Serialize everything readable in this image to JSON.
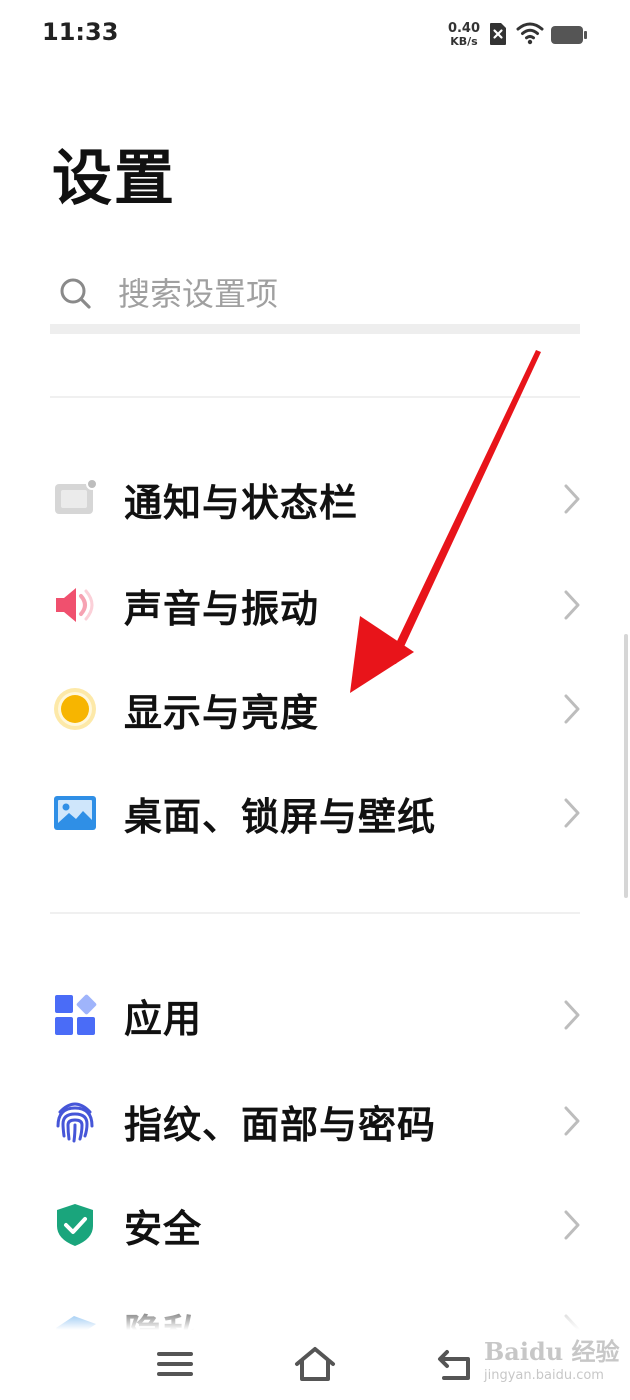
{
  "status_bar": {
    "time": "11:33",
    "net_speed": "0.40",
    "net_speed_unit": "KB/s",
    "icons": [
      "sim-disabled-icon",
      "wifi-icon",
      "battery-icon"
    ]
  },
  "page_title": "设置",
  "search": {
    "placeholder": "搜索设置项"
  },
  "groups": [
    {
      "items": [
        {
          "label": "通知与状态栏",
          "icon": "notification-icon"
        },
        {
          "label": "声音与振动",
          "icon": "speaker-icon"
        },
        {
          "label": "显示与亮度",
          "icon": "brightness-icon"
        },
        {
          "label": "桌面、锁屏与壁纸",
          "icon": "wallpaper-icon"
        }
      ]
    },
    {
      "items": [
        {
          "label": "应用",
          "icon": "apps-icon"
        },
        {
          "label": "指纹、面部与密码",
          "icon": "fingerprint-icon"
        },
        {
          "label": "安全",
          "icon": "shield-icon"
        },
        {
          "label": "隐私",
          "icon": "privacy-icon"
        }
      ]
    }
  ],
  "nav_bar": {
    "buttons": [
      "menu-icon",
      "home-icon",
      "back-icon"
    ]
  },
  "watermark": {
    "brand": "Baidu 经验",
    "url": "jingyan.baidu.com"
  },
  "colors": {
    "arrow": "#e8141a",
    "sound": "#f0506e",
    "brightness": "#f7b500",
    "wallpaper": "#2f8fe6",
    "apps": "#4a6cf7",
    "fingerprint": "#4656d8",
    "security": "#1aa57c",
    "privacy": "#2f8fe6"
  }
}
